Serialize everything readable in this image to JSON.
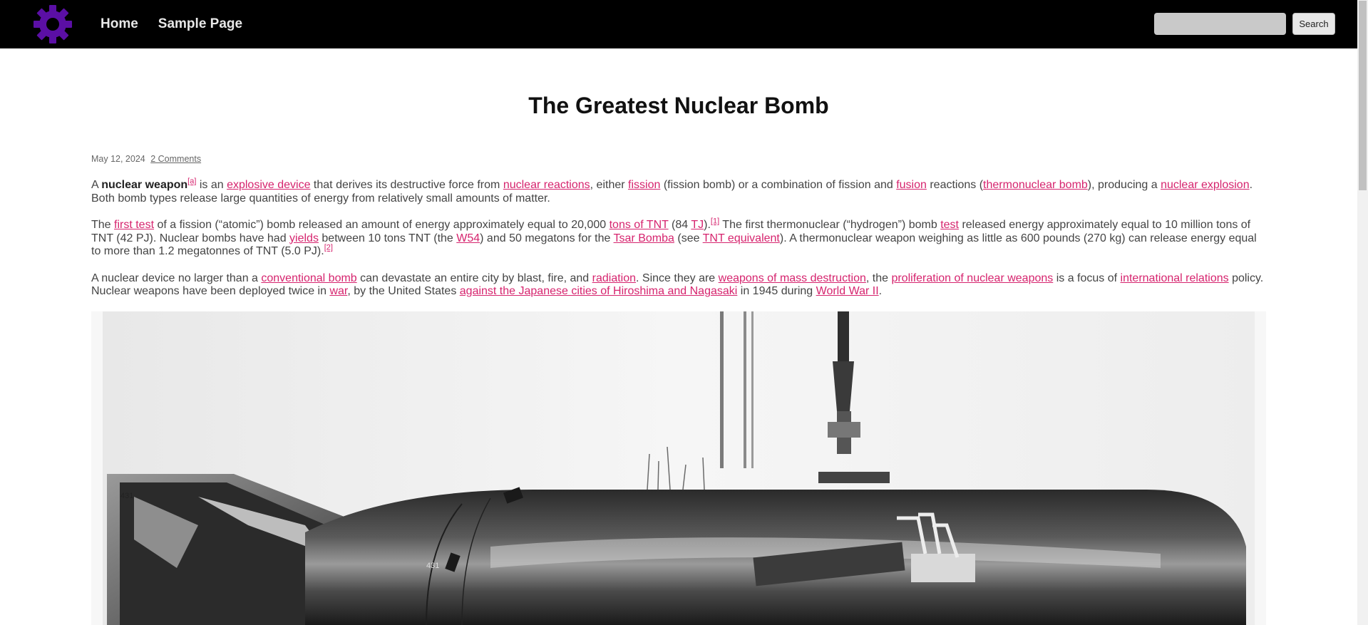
{
  "nav": {
    "logo_icon": "gear-icon",
    "logo_color": "#5b0fa5",
    "items": [
      {
        "label": "Home"
      },
      {
        "label": "Sample Page"
      }
    ]
  },
  "search": {
    "placeholder": "",
    "value": "",
    "button_label": "Search"
  },
  "post": {
    "title": "The Greatest Nuclear Bomb",
    "date": "May 12, 2024",
    "comments": "2 Comments",
    "link_color": "#d6246e",
    "p1": {
      "t1": "A ",
      "bold": "nuclear weapon",
      "sup_a": "[a]",
      "t2": " is an ",
      "l_explosive": "explosive device",
      "t3": " that derives its destructive force from ",
      "l_reactions": "nuclear reactions",
      "t4": ", either ",
      "l_fission": "fission",
      "t5": " (fission bomb) or a combination of fission and ",
      "l_fusion": "fusion",
      "t6": " reactions (",
      "l_thermo": "thermonuclear bomb",
      "t7": "), producing a ",
      "l_explosion": "nuclear explosion",
      "t8": ". Both bomb types release large quantities of energy from relatively small amounts of matter."
    },
    "p2": {
      "t1": "The ",
      "l_first_test": "first test",
      "t2": " of a fission (“atomic”) bomb released an amount of energy approximately equal to 20,000 ",
      "l_tons": "tons of TNT",
      "t3": " (84 ",
      "l_tj": "TJ",
      "t4": ").",
      "sup_1": "[1]",
      "t5": " The first thermonuclear (“hydrogen”) bomb ",
      "l_test": "test",
      "t6": " released energy approximately equal to 10 million tons of TNT (42 PJ). Nuclear bombs have had ",
      "l_yields": "yields",
      "t7": " between 10 tons TNT (the ",
      "l_w54": "W54",
      "t8": ") and 50 megatons for the ",
      "l_tsar": "Tsar Bomba",
      "t9": " (see ",
      "l_tnt_eq": "TNT equivalent",
      "t10": "). A thermonuclear weapon weighing as little as 600 pounds (270 kg) can release energy equal to more than 1.2 megatonnes of TNT (5.0 PJ).",
      "sup_2": "[2]"
    },
    "p3": {
      "t1": "A nuclear device no larger than a ",
      "l_conv": "conventional bomb",
      "t2": " can devastate an entire city by blast, fire, and ",
      "l_radiation": "radiation",
      "t3": ". Since they are ",
      "l_wmd": "weapons of mass destruction",
      "t4": ", the ",
      "l_prolif": "proliferation of nuclear weapons",
      "t5": " is a focus of ",
      "l_intl": "international relations",
      "t6": " policy. Nuclear weapons have been deployed twice in ",
      "l_war": "war",
      "t7": ", by the United States ",
      "l_hiroshima": "against the Japanese cities of Hiroshima and Nagasaki",
      "t8": " in 1945 during ",
      "l_ww2": "World War II",
      "t9": "."
    },
    "image": {
      "alt_icon": "bomb-photo"
    }
  }
}
